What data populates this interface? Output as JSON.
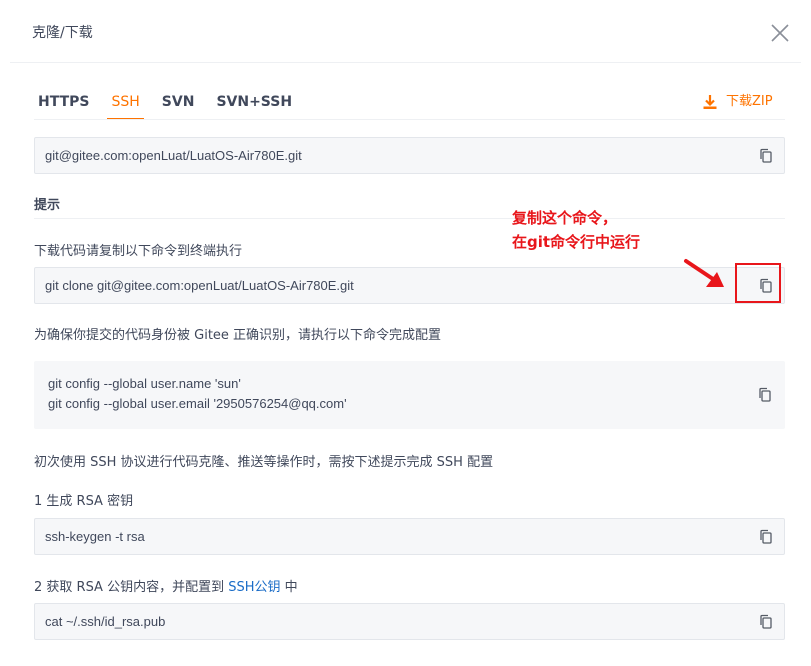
{
  "header": {
    "title": "克隆/下载"
  },
  "tabs": [
    {
      "label": "HTTPS"
    },
    {
      "label": "SSH"
    },
    {
      "label": "SVN"
    },
    {
      "label": "SVN+SSH"
    }
  ],
  "download": {
    "label": "下载ZIP"
  },
  "repo_url": "git@gitee.com:openLuat/LuatOS-Air780E.git",
  "hint": {
    "title": "提示",
    "clone_label": "下载代码请复制以下命令到终端执行",
    "clone_command": "git clone git@gitee.com:openLuat/LuatOS-Air780E.git",
    "identity_label": "为确保你提交的代码身份被 Gitee 正确识别，请执行以下命令完成配置",
    "config_line1": "git config --global user.name 'sun'",
    "config_line2": "git config --global user.email '2950576254@qq.com'",
    "ssh_intro": "初次使用 SSH 协议进行代码克隆、推送等操作时，需按下述提示完成 SSH 配置",
    "step1_label": "1 生成 RSA 密钥",
    "step1_command": "ssh-keygen -t rsa",
    "step2_prefix": "2 获取 RSA 公钥内容，并配置到 ",
    "step2_link": "SSH公钥",
    "step2_suffix": " 中",
    "step2_command": "cat ~/.ssh/id_rsa.pub"
  },
  "annotation": {
    "line1": "复制这个命令，",
    "line2": "在git命令行中运行"
  },
  "colors": {
    "accent": "#fe7300",
    "annotation": "#e8161b",
    "link": "#1a6cc7"
  }
}
